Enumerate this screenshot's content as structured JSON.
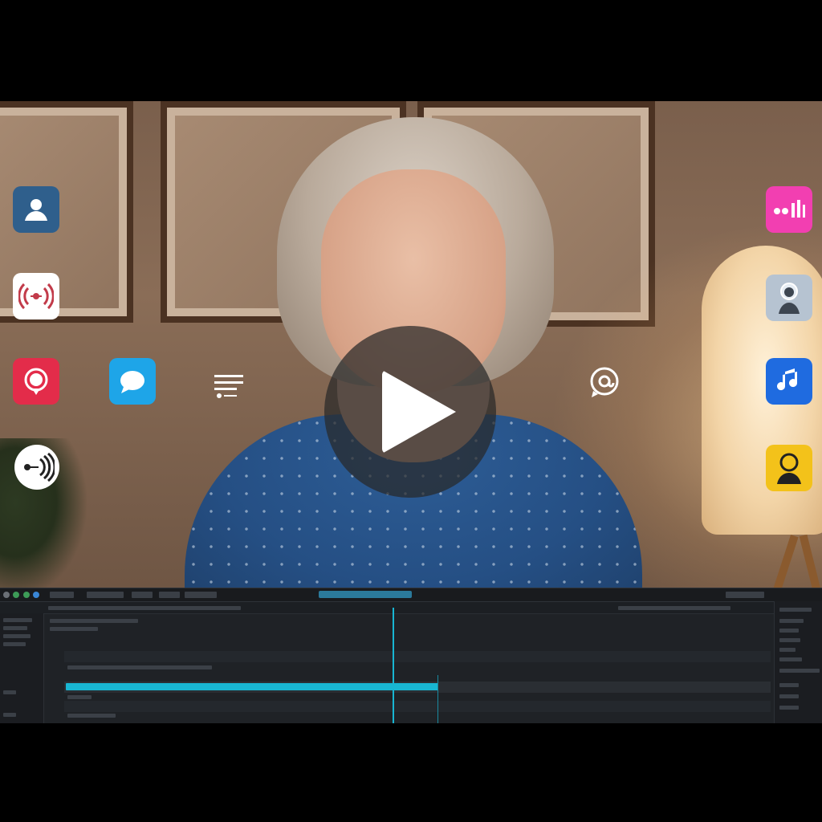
{
  "video": {
    "play_button_label": "",
    "icons": [
      {
        "name": "user-profile-icon",
        "color": "#2f5f8c"
      },
      {
        "name": "broadcast-icon",
        "color": "#ffffff"
      },
      {
        "name": "podcast-icon",
        "color": "#e32c4a"
      },
      {
        "name": "chat-bubble-icon",
        "color": "#1ea5e8"
      },
      {
        "name": "text-lines-icon",
        "color": "#ffffff"
      },
      {
        "name": "sound-wave-icon",
        "color": "#ffffff"
      },
      {
        "name": "audio-bars-icon",
        "color": "#f23fb1"
      },
      {
        "name": "avatar-icon",
        "color": "#b6c3d1"
      },
      {
        "name": "music-note-icon",
        "color": "#1f6be0"
      },
      {
        "name": "person-icon",
        "color": "#f3c21a"
      },
      {
        "name": "at-chat-icon",
        "color": "#ffffff"
      }
    ]
  },
  "editor": {
    "accent": "#18b6d2",
    "progress_fraction": 0.53
  }
}
